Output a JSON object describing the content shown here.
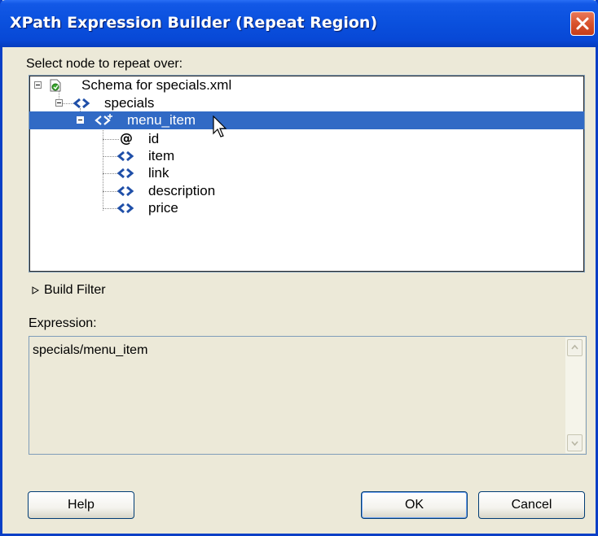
{
  "window": {
    "title": "XPath Expression Builder (Repeat Region)"
  },
  "tree": {
    "label": "Select node to repeat over:",
    "nodes": [
      {
        "label": "Schema for specials.xml",
        "icon": "schema-file-icon",
        "expanded": true
      },
      {
        "label": "specials",
        "icon": "element-icon",
        "expanded": true
      },
      {
        "label": "menu_item",
        "icon": "repeating-element-icon",
        "expanded": true,
        "selected": true
      },
      {
        "label": "id",
        "icon": "attribute-icon"
      },
      {
        "label": "item",
        "icon": "element-icon"
      },
      {
        "label": "link",
        "icon": "element-icon"
      },
      {
        "label": "description",
        "icon": "element-icon"
      },
      {
        "label": "price",
        "icon": "element-icon"
      }
    ]
  },
  "filter": {
    "label": "Build Filter",
    "expanded": false
  },
  "expression": {
    "label": "Expression:",
    "value": "specials/menu_item"
  },
  "buttons": {
    "help": "Help",
    "ok": "OK",
    "cancel": "Cancel"
  },
  "colors": {
    "titlebar": "#0a50dd",
    "selection": "#316ac5",
    "close": "#d9532d",
    "dialog_bg": "#ece9d8"
  }
}
